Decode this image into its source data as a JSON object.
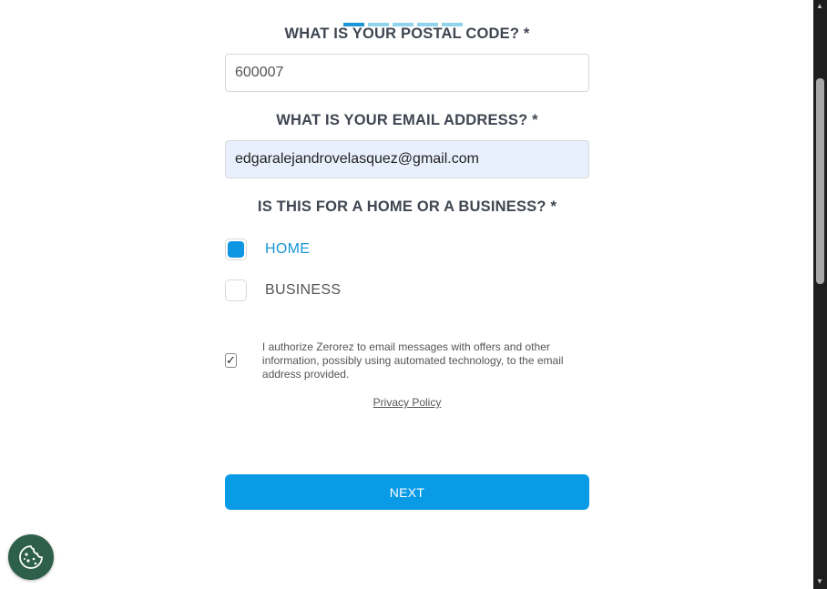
{
  "progress": {
    "total_steps": 5,
    "current_step": 1
  },
  "postal": {
    "label": "WHAT IS YOUR POSTAL CODE? *",
    "value": "600007"
  },
  "email": {
    "label": "WHAT IS YOUR EMAIL ADDRESS? *",
    "value": "edgaralejandrovelasquez@gmail.com"
  },
  "property_type": {
    "label": "IS THIS FOR A HOME OR A BUSINESS? *",
    "options": [
      {
        "label": "HOME",
        "selected": true
      },
      {
        "label": "BUSINESS",
        "selected": false
      }
    ]
  },
  "consent": {
    "checked": true,
    "text": "I authorize Zerorez to email messages with offers and other information, possibly using automated technology, to the email address provided."
  },
  "privacy_link": "Privacy Policy",
  "next_button": "NEXT",
  "cookie_settings": {
    "icon": "cookie-icon"
  },
  "colors": {
    "accent": "#0a9be6",
    "progress_inactive": "#8fd3ec",
    "cookie_bg": "#2e5f4b"
  }
}
